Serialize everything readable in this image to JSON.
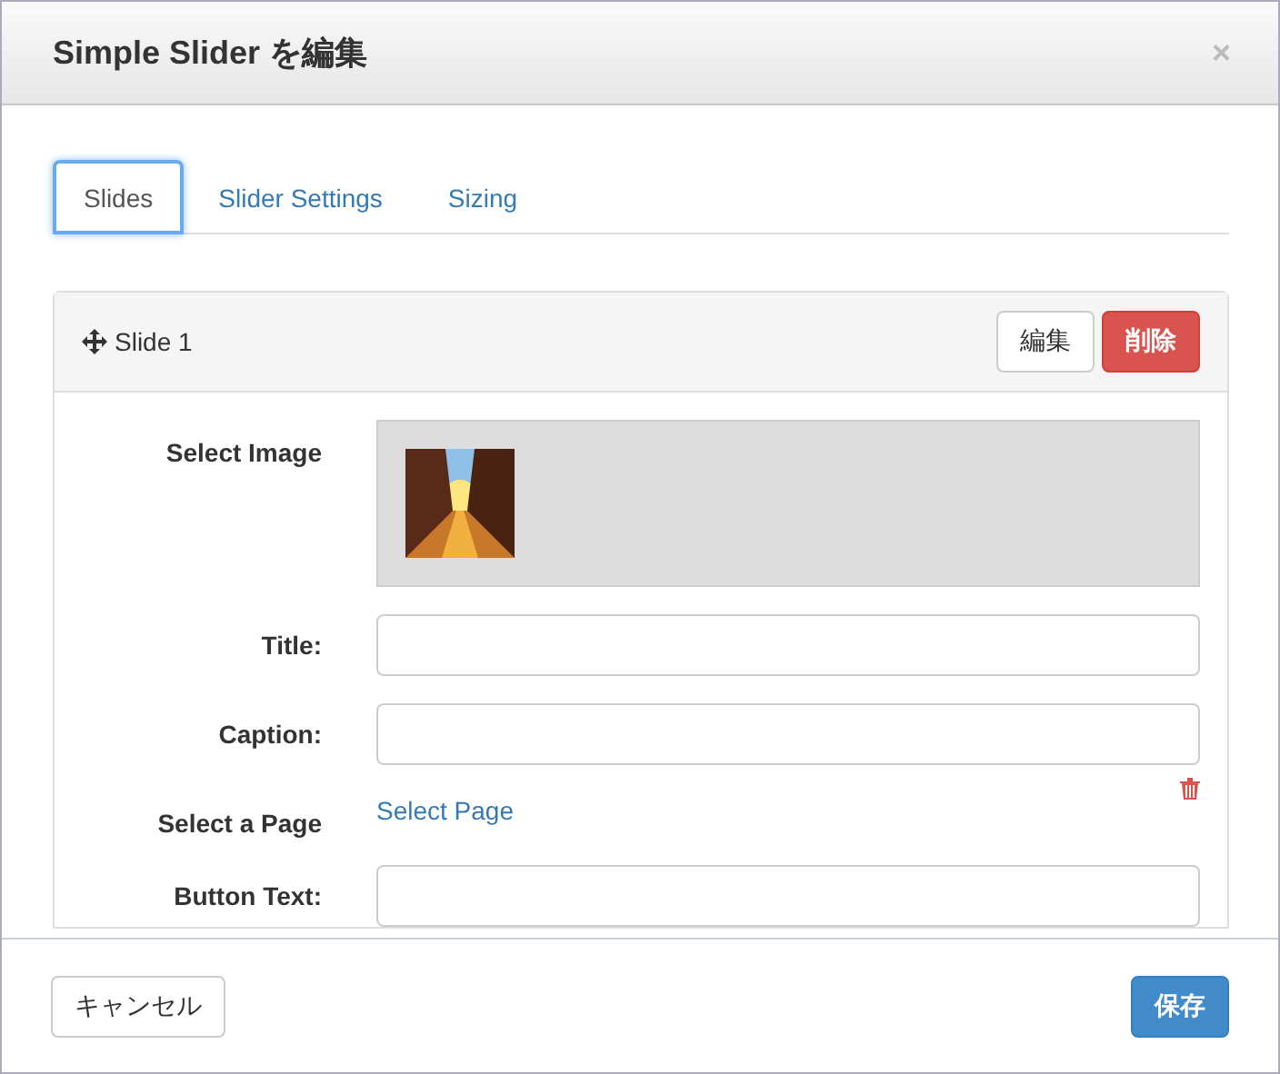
{
  "dialog": {
    "title": "Simple Slider を編集",
    "close": "×"
  },
  "tabs": [
    {
      "label": "Slides",
      "selected": true
    },
    {
      "label": "Slider Settings",
      "selected": false
    },
    {
      "label": "Sizing",
      "selected": false
    }
  ],
  "slide": {
    "title": "Slide 1",
    "buttons": [
      {
        "label": "編集",
        "kind": "default"
      },
      {
        "label": "削除",
        "kind": "danger"
      }
    ],
    "fields": [
      {
        "label": "Select Image"
      },
      {
        "kind": "text",
        "label": "Title:"
      },
      {
        "kind": "text",
        "label": "Caption:"
      },
      {
        "kind": "link",
        "label": "Select a Page",
        "link": "Select Page"
      },
      {
        "kind": "text",
        "label": "Button Text:"
      }
    ]
  },
  "footer": {
    "buttons": [
      {
        "label": "キャンセル",
        "kind": "default"
      },
      {
        "label": "保存",
        "kind": "primary"
      }
    ]
  }
}
